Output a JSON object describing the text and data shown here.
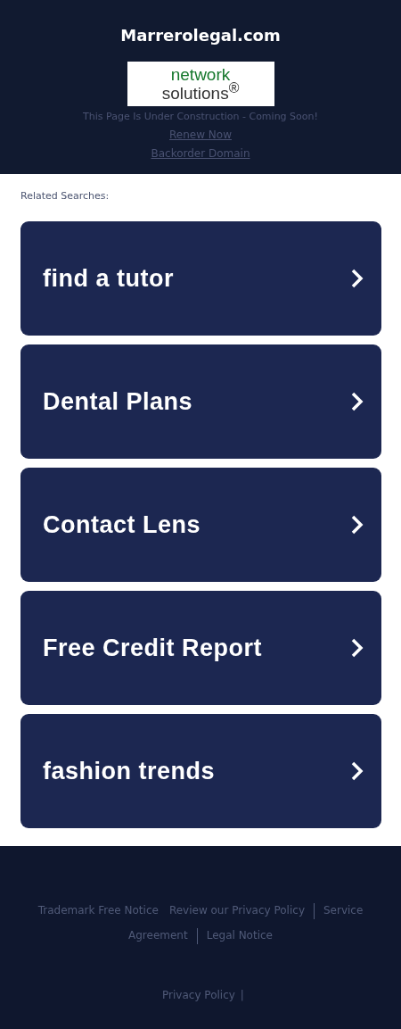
{
  "header": {
    "title": "Marrerolegal.com",
    "logo": {
      "line1": "network",
      "line2": "solutions$^{®}$"
    },
    "notice": "This Page Is Under Construction - Coming Soon!",
    "links": [
      "Renew Now",
      "Backorder Domain"
    ]
  },
  "related": {
    "heading": "Related Searches:",
    "items": [
      "find a tutor",
      "Dental Plans",
      "Contact Lens",
      "Free Credit Report",
      "fashion trends"
    ]
  },
  "footer": {
    "links": [
      {
        "label": "Trademark Free Notice",
        "divider": false
      },
      {
        "label": "Review our Privacy Policy",
        "divider": false
      },
      {
        "label": "Service",
        "divider": true
      },
      {
        "label": "Agreement",
        "divider": false
      },
      {
        "label": "Legal Notice",
        "divider": true
      }
    ],
    "bottom_link": "Privacy Policy",
    "bottom_separator": "|"
  }
}
